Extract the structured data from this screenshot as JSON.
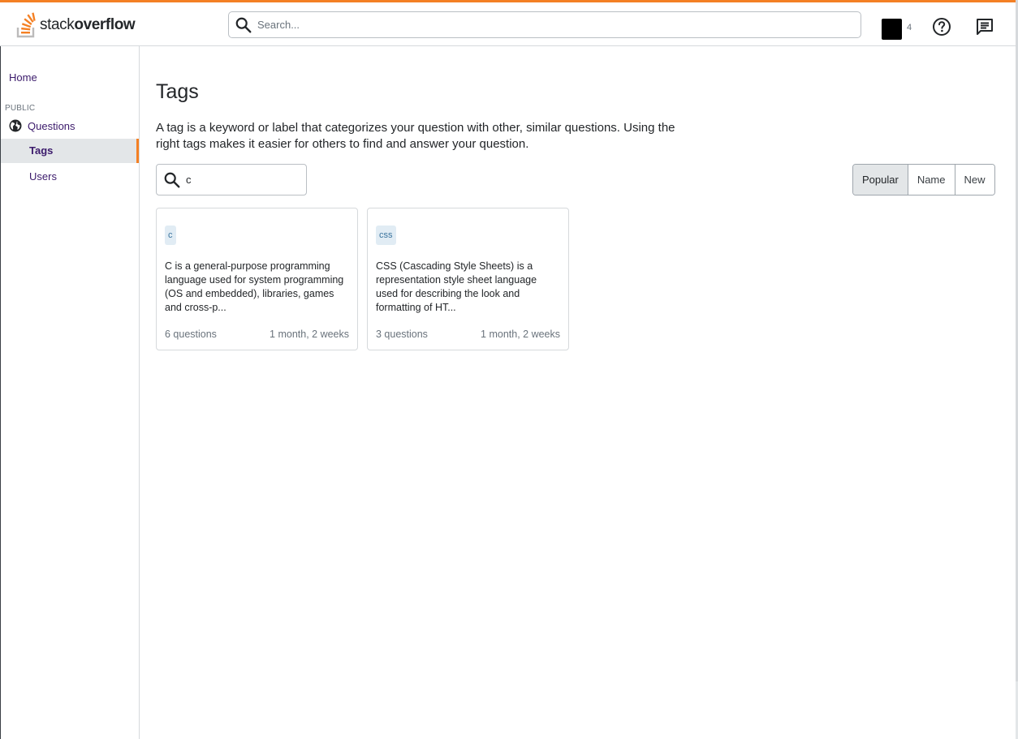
{
  "brand": {
    "logo_text_light": "stack",
    "logo_text_bold": "overflow",
    "accent_color": "#f48024"
  },
  "header": {
    "search_placeholder": "Search...",
    "reputation": "4",
    "icons": [
      "search-icon",
      "help-icon",
      "inbox-icon"
    ]
  },
  "sidebar": {
    "home": "Home",
    "section_label": "PUBLIC",
    "items": [
      {
        "label": "Questions",
        "icon": "globe-icon"
      },
      {
        "label": "Tags",
        "active": true
      },
      {
        "label": "Users"
      }
    ]
  },
  "main": {
    "title": "Tags",
    "intro": "A tag is a keyword or label that categorizes your question with other, similar questions. Using the right tags makes it easier for others to find and answer your question.",
    "filter_value": "c",
    "sort_options": [
      "Popular",
      "Name",
      "New"
    ],
    "sort_selected": "Popular",
    "tags": [
      {
        "name": "c",
        "description": "C is a general-purpose programming language used for system programming (OS and embedded), libraries, games and cross-p...",
        "count": "6 questions",
        "age": "1 month, 2 weeks"
      },
      {
        "name": "css",
        "description": "CSS (Cascading Style Sheets) is a representation style sheet language used for describing the look and formatting of HT...",
        "count": "3 questions",
        "age": "1 month, 2 weeks"
      }
    ]
  }
}
